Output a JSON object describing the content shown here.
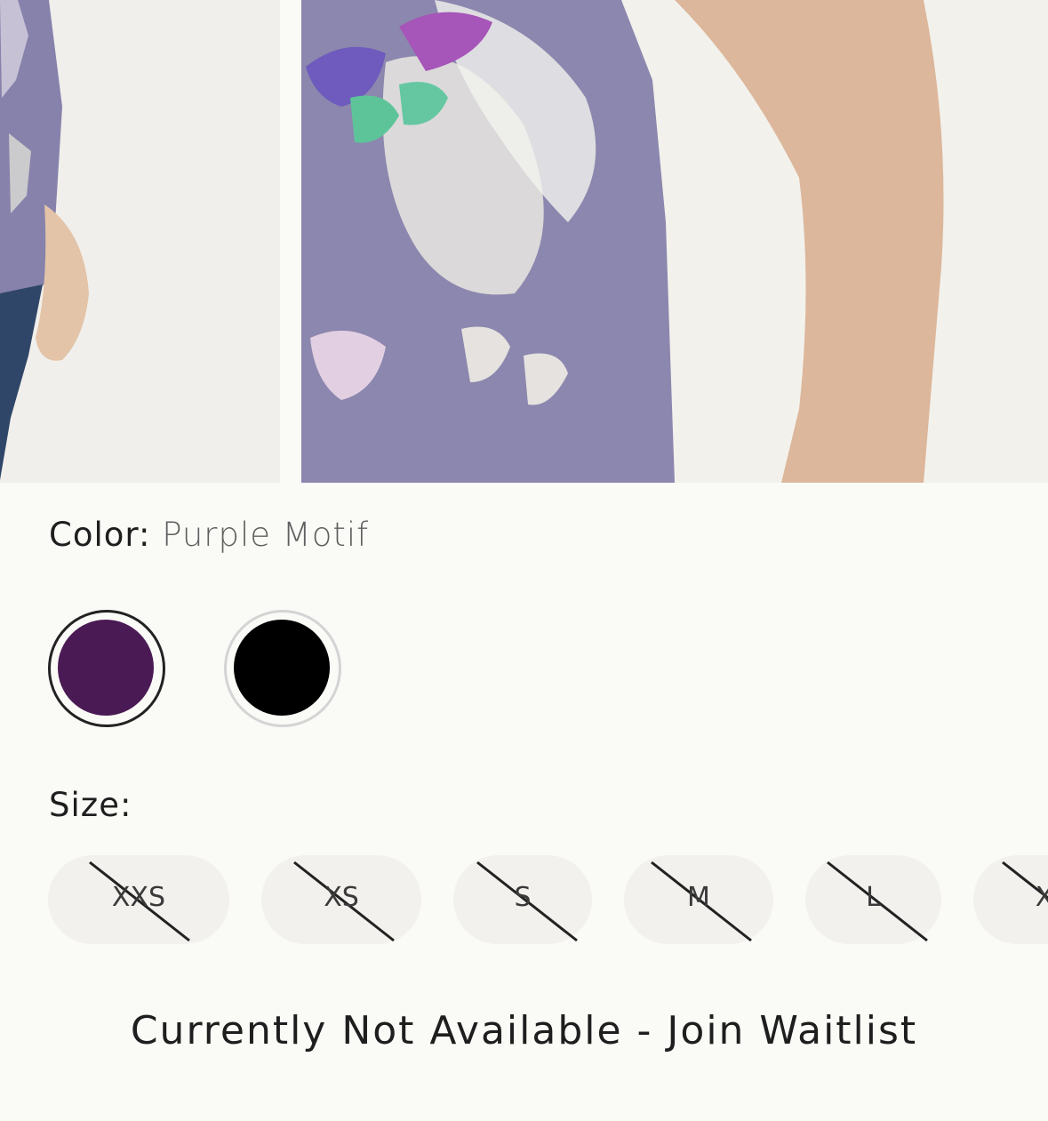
{
  "product": {
    "color_label": "Color:",
    "color_value": "Purple Motif",
    "swatches": [
      {
        "name": "purple",
        "color": "#4a1a54",
        "selected": true
      },
      {
        "name": "black",
        "color": "#000000",
        "selected": false
      }
    ],
    "size_label": "Size:",
    "sizes": [
      "XXS",
      "XS",
      "S",
      "M",
      "L",
      "X"
    ],
    "waitlist_text": "Currently Not Available - Join Waitlist"
  },
  "colors": {
    "background": "#fafaf7",
    "pill": "#f2f1ee",
    "shirt": "#8a85ad",
    "skin": "#d9b79a"
  }
}
